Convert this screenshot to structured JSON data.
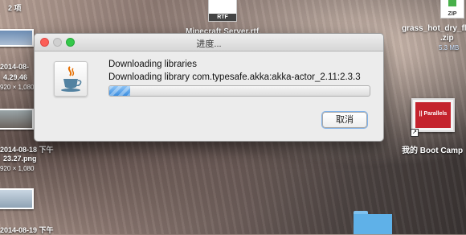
{
  "desktop": {
    "top_left_label": "2 项",
    "rtf_label": "RTF",
    "rtf_filename": "Minecraft Server.rtf",
    "zip_label": "ZIP",
    "zip_name_line1": "grass_hot_dry_fla",
    "zip_name_line2": ".zip",
    "zip_size": "5.3 MB",
    "shot1_date": "2014-08-",
    "shot1_time": "4.29.46",
    "shot1_dim": "920 × 1,080",
    "shot2_date": "2014-08-18 下午",
    "shot2_time": "23.27.png",
    "shot2_dim": "920 × 1,080",
    "shot3_date": "2014-08-19 下午",
    "parallels_name": "我的 Boot Camp",
    "parallels_brand": "|| Parallels"
  },
  "dialog": {
    "title": "进度...",
    "heading": "Downloading libraries",
    "detail": "Downloading library com.typesafe.akka:akka-actor_2.11:2.3.3",
    "progress_fraction": 0.08,
    "cancel_label": "取消",
    "icon": "java-cup-icon"
  },
  "colors": {
    "progress_blue": "#3a8de0",
    "zip_green": "#48b04a",
    "parallels_red": "#c4232d",
    "folder_blue": "#5fb1e8"
  }
}
